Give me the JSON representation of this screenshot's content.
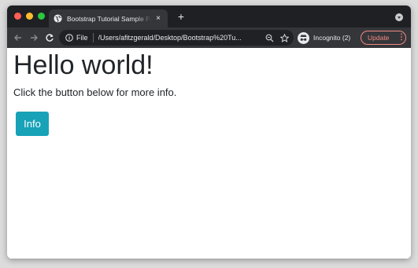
{
  "browser": {
    "tab_title": "Bootstrap Tutorial Sample Page",
    "tab_close": "×",
    "new_tab": "+",
    "omnibox_scheme": "File",
    "omnibox_url": "/Users/afitzgerald/Desktop/Bootstrap%20Tu...",
    "incognito_label": "Incognito (2)",
    "update_label": "Update",
    "update_menu": "⋮",
    "colors": {
      "titlebar": "#1f2023",
      "toolbar": "#35363a",
      "traffic_red": "#ff5f57",
      "traffic_yellow": "#febc2e",
      "traffic_green": "#28c840",
      "update_accent": "#f28b82"
    }
  },
  "page": {
    "heading": "Hello world!",
    "lead": "Click the button below for more info.",
    "info_button": "Info",
    "info_button_color": "#17a2b8"
  }
}
